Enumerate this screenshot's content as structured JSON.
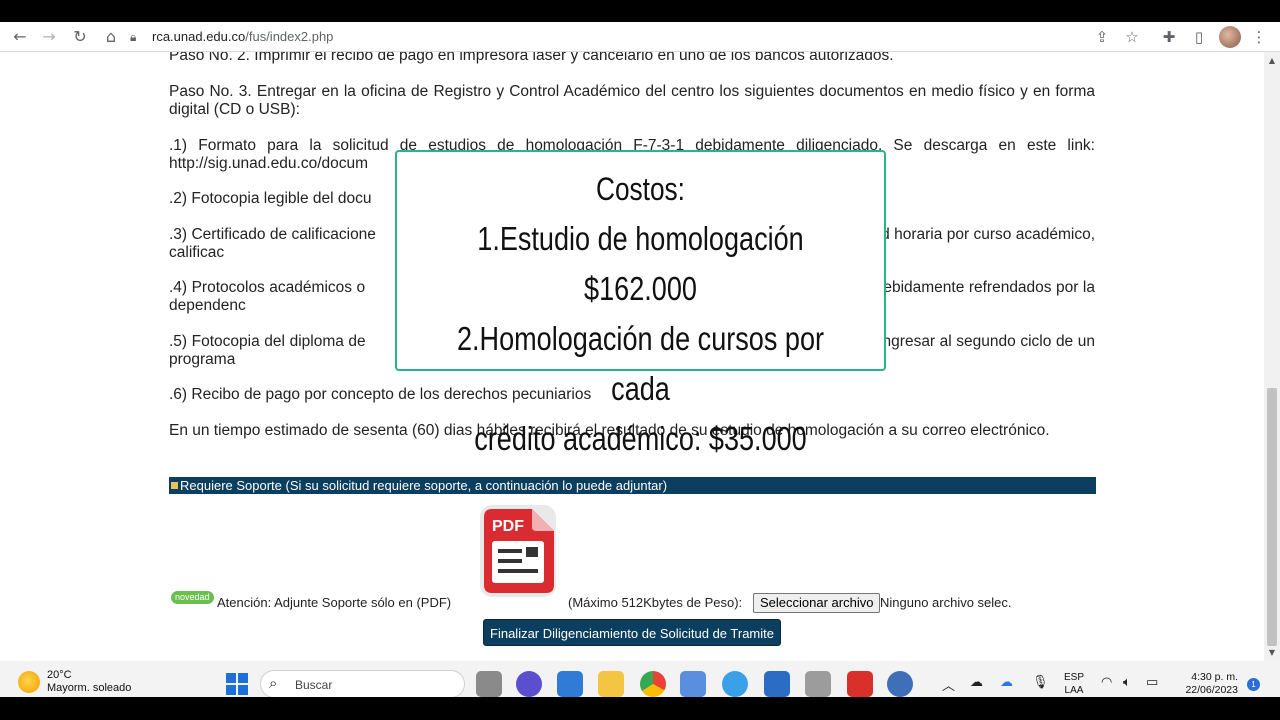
{
  "browser": {
    "url_host": "rca.unad.edu.co",
    "url_path": "/fus/index2.php"
  },
  "page": {
    "paragraphs": [
      "Paso No. 2. Imprimir el recibo de pago en impresora laser y cancelarlo en uno de los bancos autorizados.",
      "Paso No. 3. Entregar en la oficina de Registro y Control Académico del centro los siguientes documentos en medio físico y en forma digital (CD o USB):",
      ".1) Formato para la solicitud de estudios de homologación F-7-3-1 debidamente diligenciado. Se descarga en este link: http://sig.unad.edu.co/docum",
      ".2) Fotocopia legible del docu",
      ".3) Certificado de calificacione                                                                                       réditos o intensidad horaria por curso académico, calificac",
      ".4) Protocolos académicos o                                                                                            omologación, debidamente refrendados por la dependenc",
      ".5) Fotocopia del diploma de                                                                                          quienes van a ingresar al segundo ciclo de un programa",
      ".6) Recibo de pago por concepto de los derechos pecuniarios",
      "En un tiempo estimado de sesenta (60) dias hábiles recibirá el resultado de su estudio de homologación a su correo electrónico."
    ],
    "section_title": "Requiere Soporte (Si su solicitud requiere soporte, a continuación lo puede adjuntar)",
    "novedad_badge": "novedad",
    "attention_text": "Atención: Adjunte Soporte sólo en (PDF)",
    "pdf_label": "PDF",
    "max_size_text": "(Máximo 512Kbytes de Peso):",
    "file_button": "Seleccionar archivo",
    "no_file_text": "Ninguno archivo selec.",
    "submit_button": "Finalizar Diligenciamiento de Solicitud de Tramite"
  },
  "overlay": {
    "lines": [
      "Costos:",
      "1.Estudio de homologación $162.000",
      "2.Homologación de cursos por cada",
      "crédito académico: $35.000"
    ],
    "border_color": "#2ab38a"
  },
  "taskbar": {
    "weather_temp": "20°C",
    "weather_desc": "Mayorm. soleado",
    "search_placeholder": "Buscar",
    "lang_line1": "ESP",
    "lang_line2": "LAA",
    "time": "4:30 p. m.",
    "date": "22/06/2023",
    "notification_count": "1"
  },
  "colors": {
    "section_bar": "#0b3e5f",
    "badge_green": "#6ac04e"
  }
}
